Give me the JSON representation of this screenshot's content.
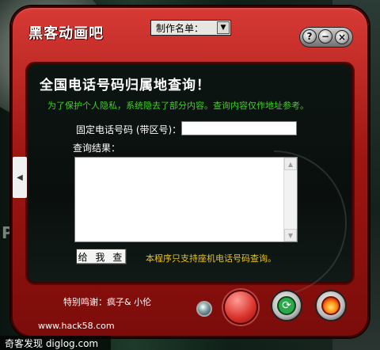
{
  "app": {
    "title": "黑客动画吧",
    "menu_select": {
      "selected": "制作名单："
    }
  },
  "title_buttons": {
    "help": "?",
    "minimize": "−",
    "close": "×"
  },
  "main": {
    "heading": "全国电话号码归属地查询！",
    "notice": "为了保护个人隐私，系统隐去了部分内容。查询内容仅作地址参考。",
    "phone_label": "固定电话号码 (带区号)：",
    "phone_value": "",
    "result_label": "查询结果：",
    "result_value": "",
    "query_button": "给 我 查",
    "support_note": "本程序只支持座机电话号码查询。"
  },
  "footer": {
    "thanks": "特别鸣谢：疯子& 小伦",
    "website": "www.hack58.com",
    "source": "奇客发现  diglog.com"
  },
  "colors": {
    "frame": "#b3201b",
    "notice": "#3bd31d",
    "support_note": "#e6c31b"
  }
}
